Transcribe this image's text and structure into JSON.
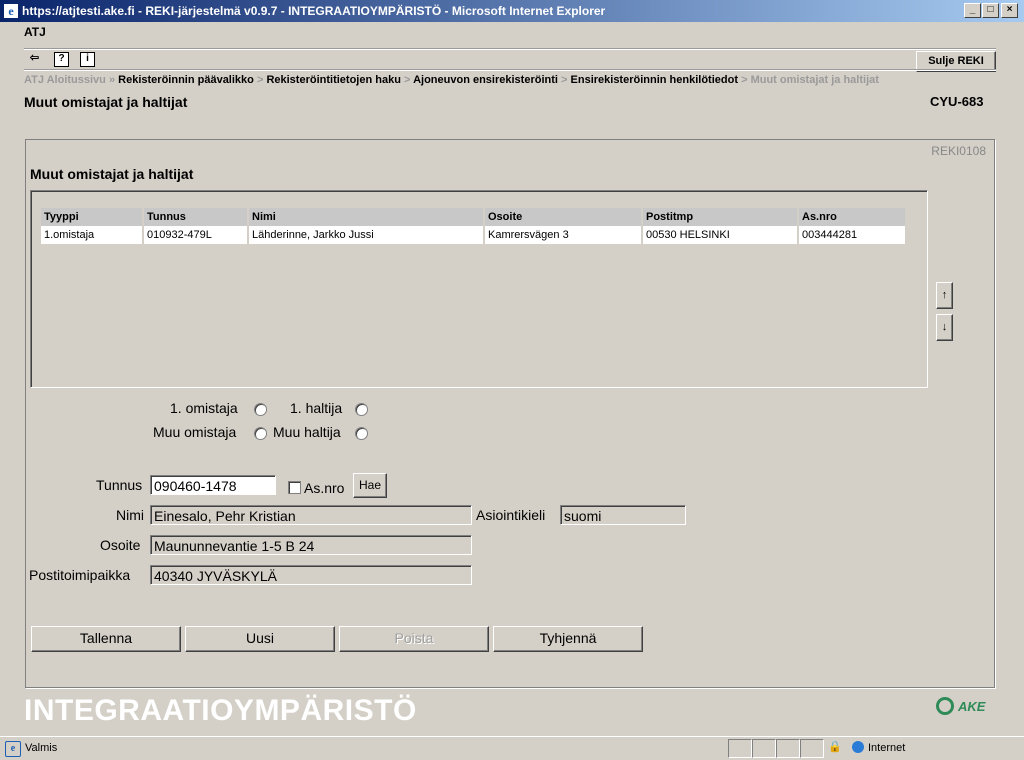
{
  "window": {
    "title": "https://atjtesti.ake.fi - REKI-järjestelmä v0.9.7 - INTEGRAATIOYMPÄRISTÖ - Microsoft Internet Explorer",
    "minimize": "_",
    "maximize": "□",
    "close": "×"
  },
  "app": {
    "name": "ATJ",
    "close_button": "Sulje REKI",
    "toolbar": {
      "back_glyph": "⇦",
      "help_glyph": "?",
      "info_glyph": "i"
    }
  },
  "breadcrumb": {
    "home": "ATJ Aloitussivu",
    "items": [
      "Rekisteröinnin päävalikko",
      "Rekisteröintitietojen haku",
      "Ajoneuvon ensirekisteröinti",
      "Ensirekisteröinnin henkilötiedot"
    ],
    "current": "Muut omistajat ja haltijat",
    "sep_first": "»",
    "sep": ">"
  },
  "page": {
    "title": "Muut omistajat ja haltijat",
    "registration": "CYU-683",
    "screen_id": "REKI0108",
    "section_title": "Muut omistajat ja haltijat"
  },
  "grid": {
    "columns": [
      "Tyyppi",
      "Tunnus",
      "Nimi",
      "Osoite",
      "Postitmp",
      "As.nro"
    ],
    "rows": [
      [
        "1.omistaja",
        "010932-479L",
        "Lähderinne, Jarkko Jussi",
        "Kamrersvägen 3",
        "00530 HELSINKI",
        "003444281"
      ]
    ],
    "scroll_up": "↑",
    "scroll_down": "↓"
  },
  "role": {
    "first_owner": "1. omistaja",
    "first_holder": "1. haltija",
    "other_owner": "Muu omistaja",
    "other_holder": "Muu haltija"
  },
  "form": {
    "tunnus_label": "Tunnus",
    "tunnus_value": "090460-1478",
    "asnro_label": "As.nro",
    "search_button": "Hae",
    "nimi_label": "Nimi",
    "nimi_value": "Einesalo, Pehr Kristian",
    "language_label": "Asiointikieli",
    "language_value": "suomi",
    "osoite_label": "Osoite",
    "osoite_value": "Maununnevantie 1-5 B 24",
    "postitoimipaikka_label": "Postitoimipaikka",
    "postitoimipaikka_value": "40340 JYVÄSKYLÄ"
  },
  "actions": {
    "save": "Tallenna",
    "new": "Uusi",
    "delete": "Poista",
    "clear": "Tyhjennä"
  },
  "footer": {
    "environment": "INTEGRAATIOYMPÄRISTÖ",
    "logo_text": "AKE"
  },
  "status": {
    "text": "Valmis",
    "zone": "Internet"
  }
}
